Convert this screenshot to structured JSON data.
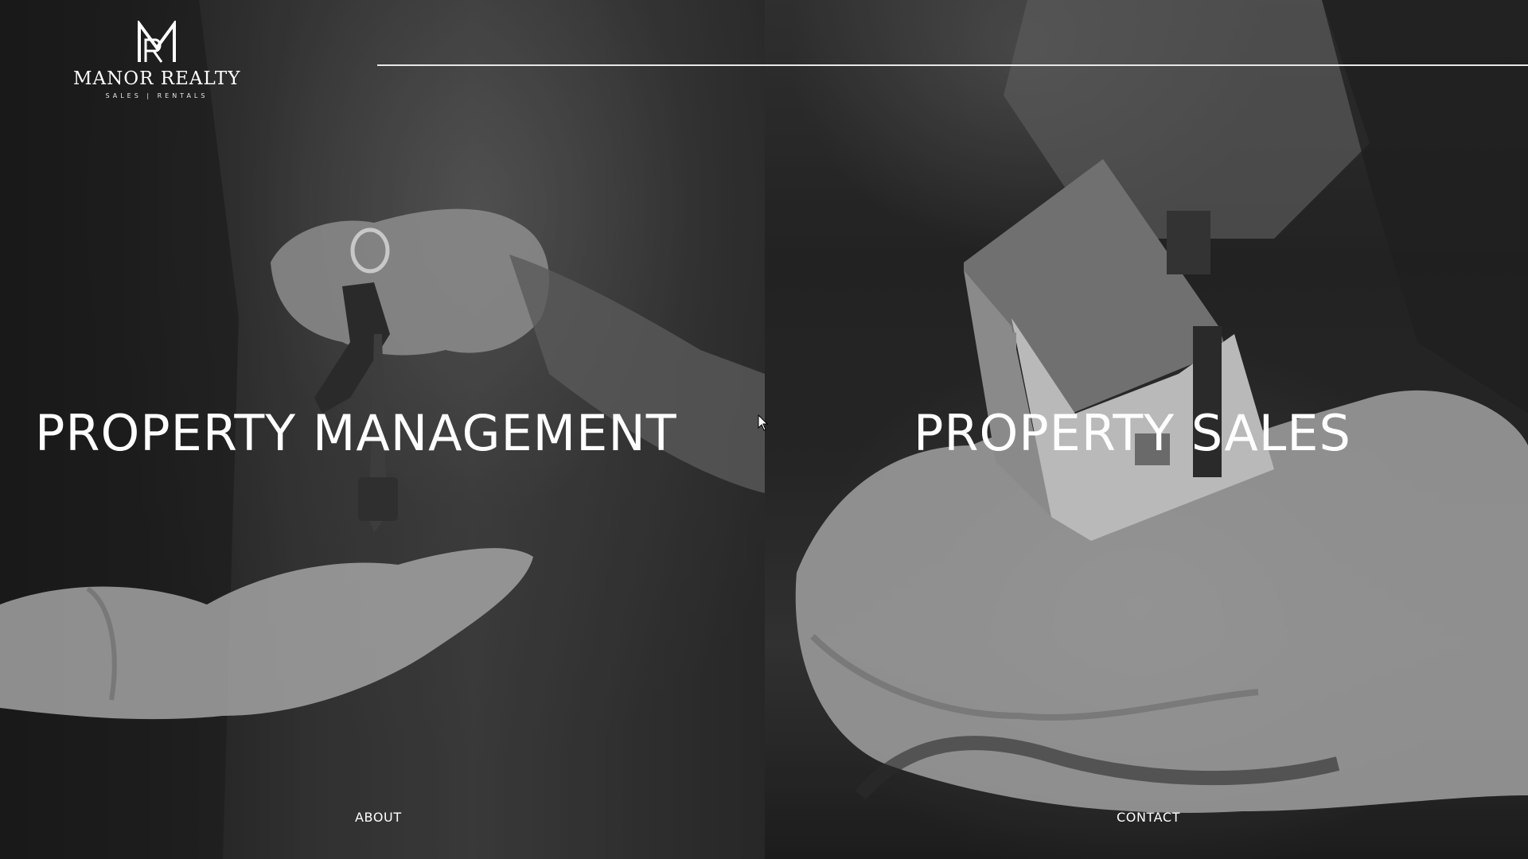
{
  "brand": {
    "name": "MANOR REALTY",
    "tagline": "SALES  |  RENTALS",
    "logo_icon": "mr-monogram-icon"
  },
  "panels": [
    {
      "title": "PROPERTY MANAGEMENT",
      "image": "hand-giving-keys-photo",
      "link_label": "ABOUT"
    },
    {
      "title": "PROPERTY SALES",
      "image": "hands-holding-house-photo",
      "link_label": "CONTACT"
    }
  ],
  "colors": {
    "text": "#ffffff",
    "overlay": "#1c1c1c",
    "rule": "#e8e8e8"
  },
  "cursor_icon": "mouse-pointer-icon"
}
